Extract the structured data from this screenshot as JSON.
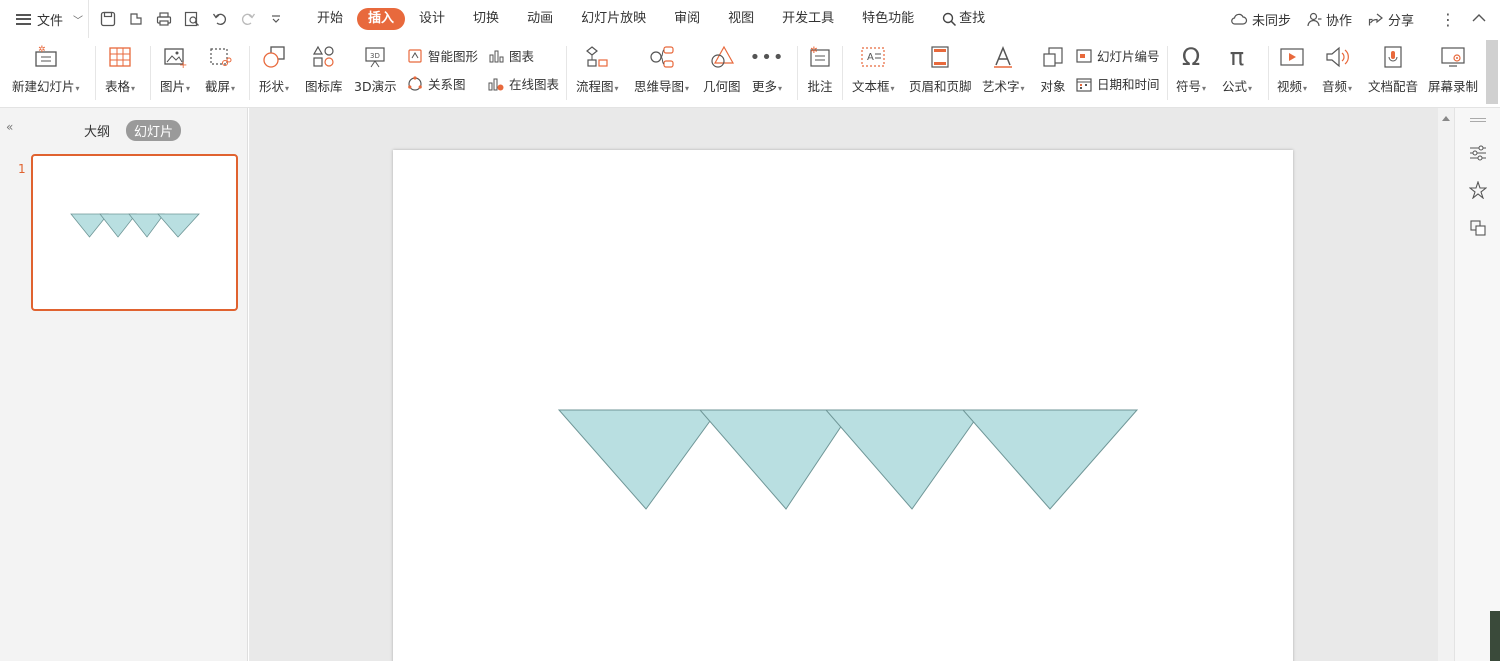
{
  "menubar": {
    "file_label": "文件",
    "tabs": [
      {
        "label": "开始",
        "active": false
      },
      {
        "label": "插入",
        "active": true
      },
      {
        "label": "设计",
        "active": false
      },
      {
        "label": "切换",
        "active": false
      },
      {
        "label": "动画",
        "active": false
      },
      {
        "label": "幻灯片放映",
        "active": false
      },
      {
        "label": "审阅",
        "active": false
      },
      {
        "label": "视图",
        "active": false
      },
      {
        "label": "开发工具",
        "active": false
      },
      {
        "label": "特色功能",
        "active": false
      }
    ],
    "search_label": "查找",
    "sync_label": "未同步",
    "collab_label": "协作",
    "share_label": "分享"
  },
  "ribbon": {
    "new_slide": "新建幻灯片",
    "table": "表格",
    "picture": "图片",
    "screenshot": "截屏",
    "shape": "形状",
    "icon_lib": "图标库",
    "demo3d": "3D演示",
    "smart_art": "智能图形",
    "chart": "图表",
    "relation": "关系图",
    "online_chart": "在线图表",
    "flowchart": "流程图",
    "mindmap": "思维导图",
    "geometry": "几何图",
    "more": "更多",
    "comment": "批注",
    "textbox": "文本框",
    "header_footer": "页眉和页脚",
    "wordart": "艺术字",
    "object": "对象",
    "slide_number": "幻灯片编号",
    "datetime": "日期和时间",
    "symbol": "符号",
    "formula": "公式",
    "video": "视频",
    "audio": "音频",
    "doc_voice": "文档配音",
    "screen_record": "屏幕录制"
  },
  "leftpanel": {
    "outline_tab": "大纲",
    "slides_tab": "幻灯片",
    "slide_number": "1"
  },
  "colors": {
    "accent": "#e8693c",
    "triangle_fill": "#b9dfe1",
    "triangle_stroke": "#6f9697"
  }
}
